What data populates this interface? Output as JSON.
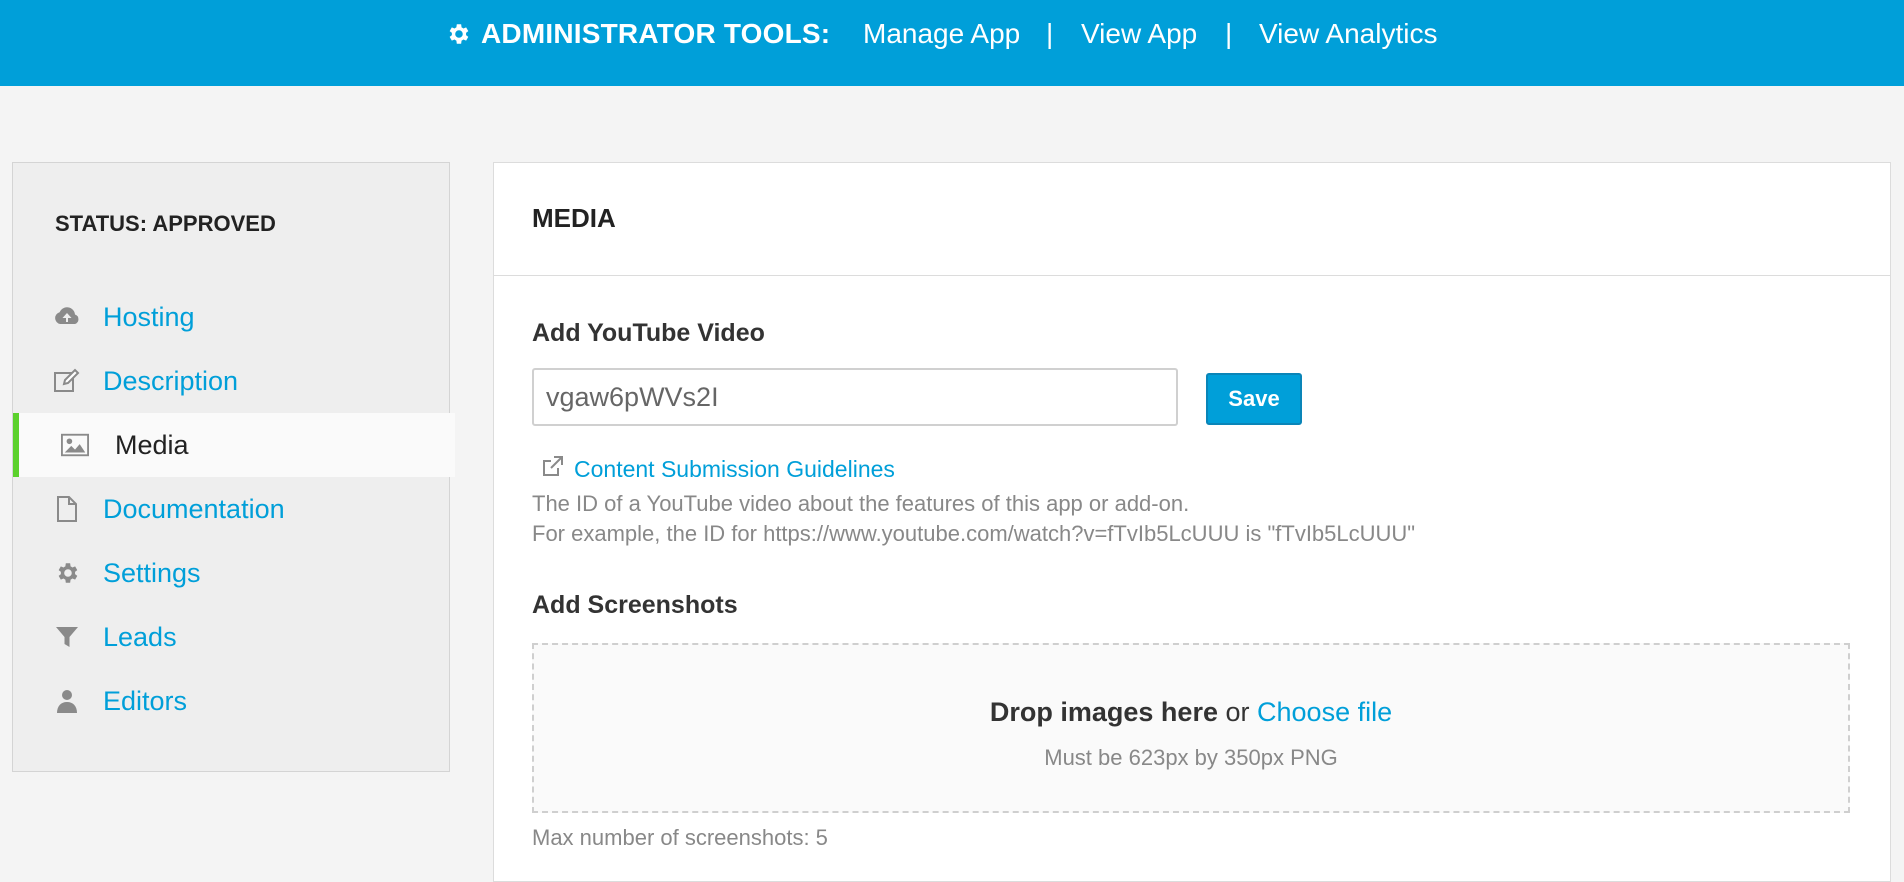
{
  "topbar": {
    "title": "ADMINISTRATOR TOOLS:",
    "links": [
      "Manage App",
      "View App",
      "View Analytics"
    ],
    "separator": "|",
    "icon": "gear-icon",
    "background": "#009fd9"
  },
  "sidebar": {
    "status": "STATUS: APPROVED",
    "active_color": "#5bd12c",
    "items": [
      {
        "label": "Hosting",
        "icon": "cloud-upload-icon"
      },
      {
        "label": "Description",
        "icon": "edit-icon"
      },
      {
        "label": "Media",
        "icon": "image-icon",
        "active": true
      },
      {
        "label": "Documentation",
        "icon": "document-icon"
      },
      {
        "label": "Settings",
        "icon": "gear-icon"
      },
      {
        "label": "Leads",
        "icon": "filter-icon"
      },
      {
        "label": "Editors",
        "icon": "user-icon"
      }
    ]
  },
  "main": {
    "title": "MEDIA",
    "youtube": {
      "heading": "Add YouTube Video",
      "value": "vgaw6pWVs2I",
      "save_label": "Save",
      "guidelines_label": "Content Submission Guidelines",
      "help_line1": "The ID of a YouTube video about the features of this app or add-on.",
      "help_line2": "For example, the ID for https://www.youtube.com/watch?v=fTvIb5LcUUU is \"fTvIb5LcUUU\""
    },
    "screenshots": {
      "heading": "Add Screenshots",
      "drop_text": "Drop images here",
      "or_text": "or",
      "choose_label": "Choose file",
      "requirement": "Must be 623px by 350px PNG",
      "max_note": "Max number of screenshots: 5"
    }
  }
}
